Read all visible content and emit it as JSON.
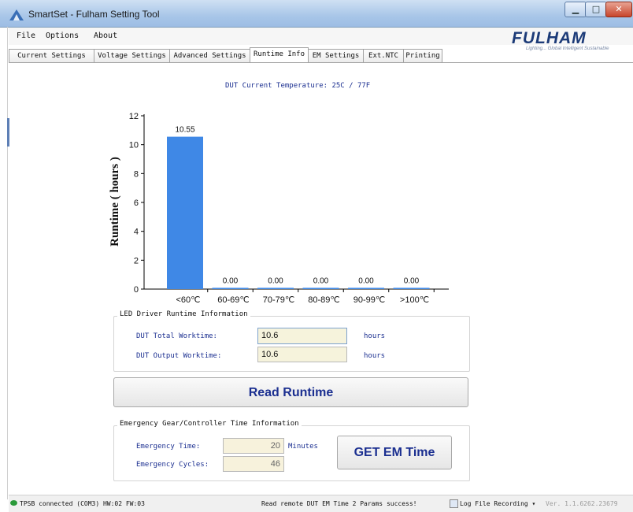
{
  "window": {
    "title": "SmartSet - Fulham Setting Tool",
    "minimize_glyph": "▁",
    "maximize_glyph": "□",
    "close_glyph": "✕"
  },
  "menu": {
    "items": [
      "File",
      "Options",
      "About"
    ]
  },
  "logo": {
    "text": "FULHAM",
    "tagline": "Lighting... Global Intelligent Sustainable"
  },
  "tabs": [
    {
      "label": "Current Settings"
    },
    {
      "label": "Voltage Settings"
    },
    {
      "label": "Advanced Settings"
    },
    {
      "label": "Runtime Info"
    },
    {
      "label": "EM Settings"
    },
    {
      "label": "Ext.NTC"
    },
    {
      "label": "Printing"
    }
  ],
  "active_tab": "Runtime Info",
  "dut_temperature": "DUT Current Temperature: 25C / 77F",
  "chart_data": {
    "type": "bar",
    "categories": [
      "<60℃",
      "60-69℃",
      "70-79℃",
      "80-89℃",
      "90-99℃",
      ">100℃"
    ],
    "values": [
      10.55,
      0.0,
      0.0,
      0.0,
      0.0,
      0.0
    ],
    "value_labels": [
      "10.55",
      "0.00",
      "0.00",
      "0.00",
      "0.00",
      "0.00"
    ],
    "ylabel": "Runtime ( hours )",
    "yticks": [
      "0",
      "2",
      "4",
      "6",
      "8",
      "10",
      "12"
    ],
    "ylim": [
      0,
      12
    ],
    "bar_color": "#3f88e6",
    "grid": false
  },
  "led_runtime": {
    "title": "LED Driver Runtime Information",
    "total_label": "DUT Total Worktime:",
    "total_value": "10.6",
    "total_unit": "hours",
    "output_label": "DUT Output Worktime:",
    "output_value": "10.6",
    "output_unit": "hours"
  },
  "read_runtime_button": "Read Runtime",
  "em_info": {
    "title": "Emergency Gear/Controller Time Information",
    "time_label": "Emergency Time:",
    "time_value": "20",
    "time_unit": "Minutes",
    "cycles_label": "Emergency Cycles:",
    "cycles_value": "46",
    "button": "GET EM Time"
  },
  "status": {
    "connection": "TPSB connected (COM3) HW:02 FW:03",
    "message": "Read remote DUT EM Time 2 Params success!",
    "log": "Log File Recording ▾",
    "version": "Ver. 1.1.6262.23679"
  },
  "colors": {
    "accent": "#1b2f90",
    "bar": "#3f88e6",
    "field_bg": "#f6f3dc"
  }
}
